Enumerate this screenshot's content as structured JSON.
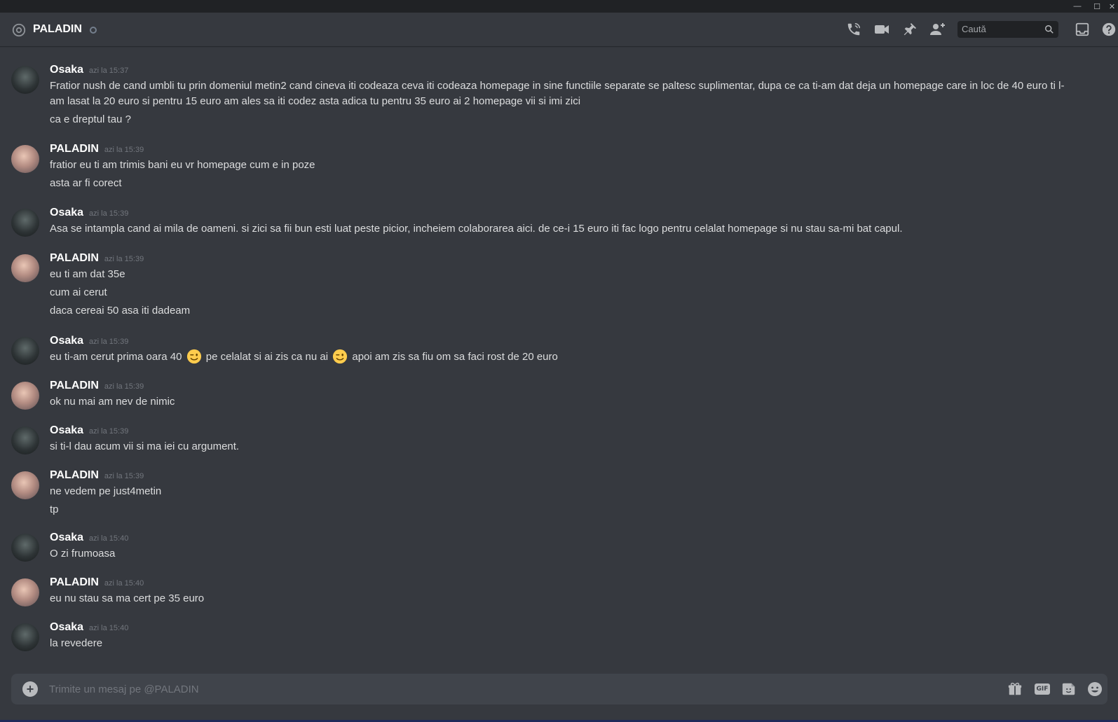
{
  "window": {
    "minimize": "—",
    "maximize": "☐",
    "close": "✕"
  },
  "header": {
    "title": "PALADIN",
    "search_placeholder": "Caută"
  },
  "colors": {
    "background": "#36393f",
    "titlebar": "#202225",
    "username": "#ffffff",
    "timestamp": "#72767d",
    "text": "#dcddde",
    "composer": "#40444b"
  },
  "icons": {
    "header": [
      "at-icon",
      "call-icon",
      "video-icon",
      "pin-icon",
      "add-friend-icon",
      "search-icon",
      "inbox-icon",
      "help-icon"
    ],
    "composer": [
      "add-attachment-icon",
      "gift-icon",
      "gif-icon",
      "sticker-icon",
      "emoji-icon"
    ]
  },
  "messages": [
    {
      "author": "Osaka",
      "avatar": "osaka",
      "time": "azi la 15:37",
      "lines": [
        "Fratior nush de cand umbli tu prin domeniul metin2 cand cineva iti codeaza ceva iti codeaza homepage in sine functiile separate se paltesc suplimentar, dupa ce ca ti-am dat deja un homepage care in loc de 40 euro ti l-am lasat la 20 euro si pentru 15 euro am ales sa iti codez asta adica tu pentru 35 euro ai 2 homepage vii si imi zici",
        "ca e dreptul tau ?"
      ]
    },
    {
      "author": "PALADIN",
      "avatar": "paladin",
      "time": "azi la 15:39",
      "lines": [
        "fratior eu ti am trimis bani eu vr homepage cum e in poze",
        "asta ar fi corect"
      ]
    },
    {
      "author": "Osaka",
      "avatar": "osaka",
      "time": "azi la 15:39",
      "lines": [
        "Asa se intampla cand ai mila de oameni. si zici sa fii bun esti luat peste picior, incheiem colaborarea aici. de ce-i 15 euro iti fac logo pentru celalat homepage si nu stau sa-mi bat capul."
      ]
    },
    {
      "author": "PALADIN",
      "avatar": "paladin",
      "time": "azi la 15:39",
      "lines": [
        "eu ti am dat 35e",
        "cum ai cerut",
        "daca cereai 50 asa iti dadeam"
      ]
    },
    {
      "author": "Osaka",
      "avatar": "osaka",
      "time": "azi la 15:39",
      "segments": [
        "eu ti-am cerut prima oara 40",
        "pe celalat si ai zis ca nu ai",
        "apoi am zis sa fiu om sa faci rost de 20 euro"
      ],
      "emoji": "wink-emoji"
    },
    {
      "author": "PALADIN",
      "avatar": "paladin",
      "time": "azi la 15:39",
      "lines": [
        "ok nu mai am nev de nimic"
      ]
    },
    {
      "author": "Osaka",
      "avatar": "osaka",
      "time": "azi la 15:39",
      "lines": [
        "si ti-l dau acum vii si ma iei cu argument."
      ]
    },
    {
      "author": "PALADIN",
      "avatar": "paladin",
      "time": "azi la 15:39",
      "lines": [
        "ne vedem pe just4metin",
        "tp"
      ]
    },
    {
      "author": "Osaka",
      "avatar": "osaka",
      "time": "azi la 15:40",
      "lines": [
        "O zi frumoasa"
      ]
    },
    {
      "author": "PALADIN",
      "avatar": "paladin",
      "time": "azi la 15:40",
      "lines": [
        "eu nu stau sa ma cert pe 35 euro"
      ]
    },
    {
      "author": "Osaka",
      "avatar": "osaka",
      "time": "azi la 15:40",
      "lines": [
        "la revedere"
      ]
    }
  ],
  "composer": {
    "placeholder": "Trimite un mesaj pe @PALADIN",
    "attach_symbol": "+",
    "gif_label": "GIF"
  }
}
